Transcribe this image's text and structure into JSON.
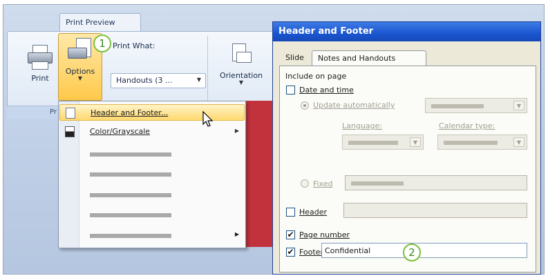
{
  "ribbon": {
    "tab_label": "Print Preview",
    "print_label": "Print",
    "options_label": "Options",
    "print_what_label": "Print What:",
    "print_what_value": "Handouts (3 ...",
    "orientation_label": "Orientation",
    "group_label": "Pr"
  },
  "callouts": {
    "one": "1",
    "two": "2"
  },
  "options_menu": {
    "items": [
      {
        "label": "Header and Footer...",
        "highlighted": true,
        "icon": "header-footer-icon"
      },
      {
        "label": "Color/Grayscale",
        "submenu": true,
        "icon": "color-grayscale-icon"
      }
    ]
  },
  "dialog": {
    "title": "Header and Footer",
    "tabs": [
      "Slide",
      "Notes and Handouts"
    ],
    "active_tab": "Notes and Handouts",
    "include_on_page": "Include on page",
    "date_time_label": "Date and time",
    "date_time_checked": false,
    "update_auto_label": "Update automatically",
    "update_auto_selected": true,
    "language_label": "Language:",
    "calendar_label": "Calendar type:",
    "fixed_label": "Fixed",
    "header_label": "Header",
    "header_checked": false,
    "page_number_label": "Page number",
    "page_number_checked": true,
    "footer_label": "Footer",
    "footer_checked": true,
    "footer_value": "Confidential"
  },
  "colors": {
    "highlight": "#ffd96f",
    "titlebar": "#1a56d0",
    "callout_ring": "#7cbf3a",
    "band": "#c2323d"
  }
}
